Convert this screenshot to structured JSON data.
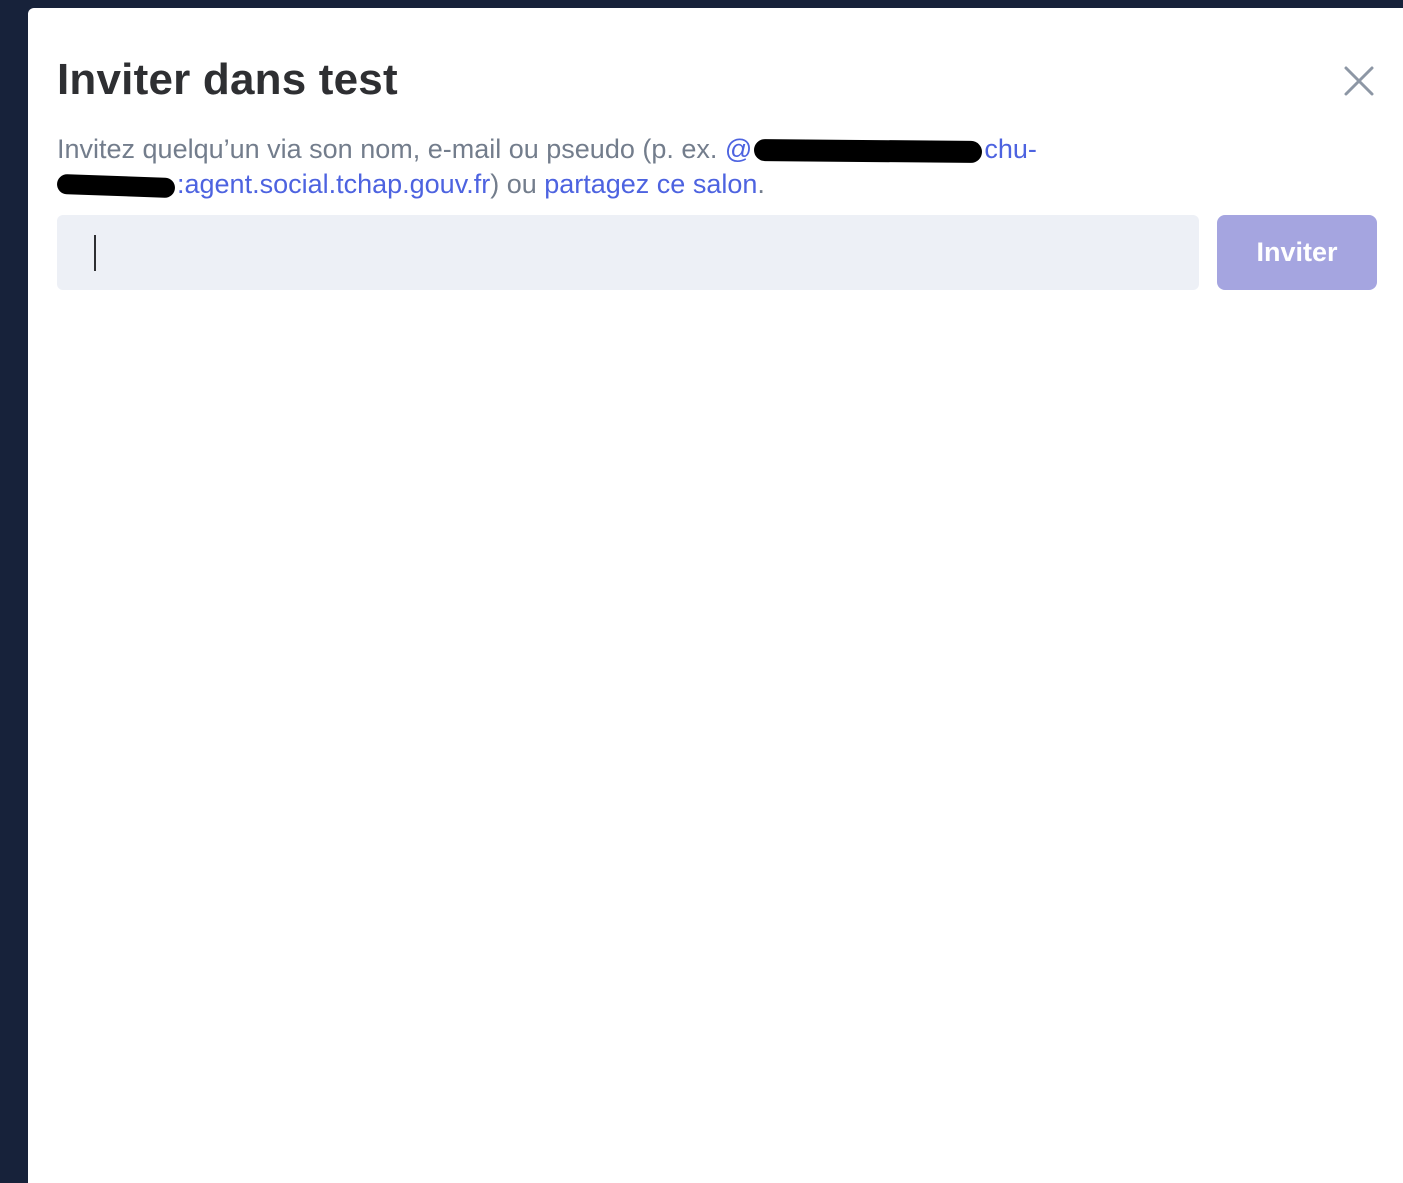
{
  "dialog": {
    "title": "Inviter dans test",
    "close_icon": "close-icon",
    "description": {
      "prefix": "Invitez quelqu’un via son nom, e-mail ou pseudo (p. ex. ",
      "example_id_start": "@",
      "example_id_mid": "chu-",
      "example_id_end": ":agent.social.tchap.gouv.fr",
      "middle": ") ou ",
      "share_link": "partagez ce salon",
      "suffix": "."
    },
    "input": {
      "value": "",
      "placeholder": ""
    },
    "invite_button_label": "Inviter"
  },
  "colors": {
    "backdrop": "#17223a",
    "link": "#4d63e0",
    "button_disabled": "#a5a5e0",
    "input_bg": "#edf0f6"
  }
}
